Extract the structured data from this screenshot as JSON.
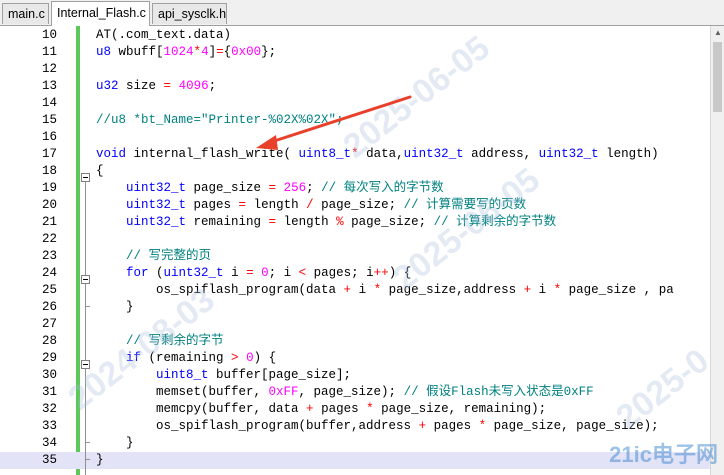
{
  "tabs": [
    {
      "label": "main.c",
      "active": false
    },
    {
      "label": "Internal_Flash.c",
      "active": true
    },
    {
      "label": "api_sysclk.h",
      "active": false
    }
  ],
  "lines": [
    {
      "n": "10",
      "code": "AT(.com_text.data)"
    },
    {
      "n": "11",
      "code": "u8 wbuff[1024*4]={0x00};"
    },
    {
      "n": "12",
      "code": ""
    },
    {
      "n": "13",
      "code": "u32 size = 4096;"
    },
    {
      "n": "14",
      "code": ""
    },
    {
      "n": "15",
      "code": "//u8 *bt_Name=\"Printer-%02X%02X\";"
    },
    {
      "n": "16",
      "code": ""
    },
    {
      "n": "17",
      "code": "void internal_flash_write( uint8_t* data,uint32_t address, uint32_t length)"
    },
    {
      "n": "18",
      "code": "{"
    },
    {
      "n": "19",
      "code": "    uint32_t page_size = 256; // 每次写入的字节数"
    },
    {
      "n": "20",
      "code": "    uint32_t pages = length / page_size; // 计算需要写的页数"
    },
    {
      "n": "21",
      "code": "    uint32_t remaining = length % page_size; // 计算剩余的字节数"
    },
    {
      "n": "22",
      "code": ""
    },
    {
      "n": "23",
      "code": "    // 写完整的页"
    },
    {
      "n": "24",
      "code": "    for (uint32_t i = 0; i < pages; i++) {"
    },
    {
      "n": "25",
      "code": "        os_spiflash_program(data + i * page_size,address + i * page_size , pa"
    },
    {
      "n": "26",
      "code": "    }"
    },
    {
      "n": "27",
      "code": ""
    },
    {
      "n": "28",
      "code": "    // 写剩余的字节"
    },
    {
      "n": "29",
      "code": "    if (remaining > 0) {"
    },
    {
      "n": "30",
      "code": "        uint8_t buffer[page_size];"
    },
    {
      "n": "31",
      "code": "        memset(buffer, 0xFF, page_size); // 假设Flash未写入状态是0xFF"
    },
    {
      "n": "32",
      "code": "        memcpy(buffer, data + pages * page_size, remaining);"
    },
    {
      "n": "33",
      "code": "        os_spiflash_program(buffer,address + pages * page_size, page_size);"
    },
    {
      "n": "34",
      "code": "    }"
    },
    {
      "n": "35",
      "code": "}"
    }
  ],
  "watermarks": [
    "2025-06-05",
    "2024-08-03",
    "2025-06-05",
    "2025-0"
  ],
  "logo_text": "21ic电子网",
  "colors": {
    "change_bar": "#5cc85c",
    "arrow": "#e8402a",
    "current_line": "#e3e3f7"
  }
}
